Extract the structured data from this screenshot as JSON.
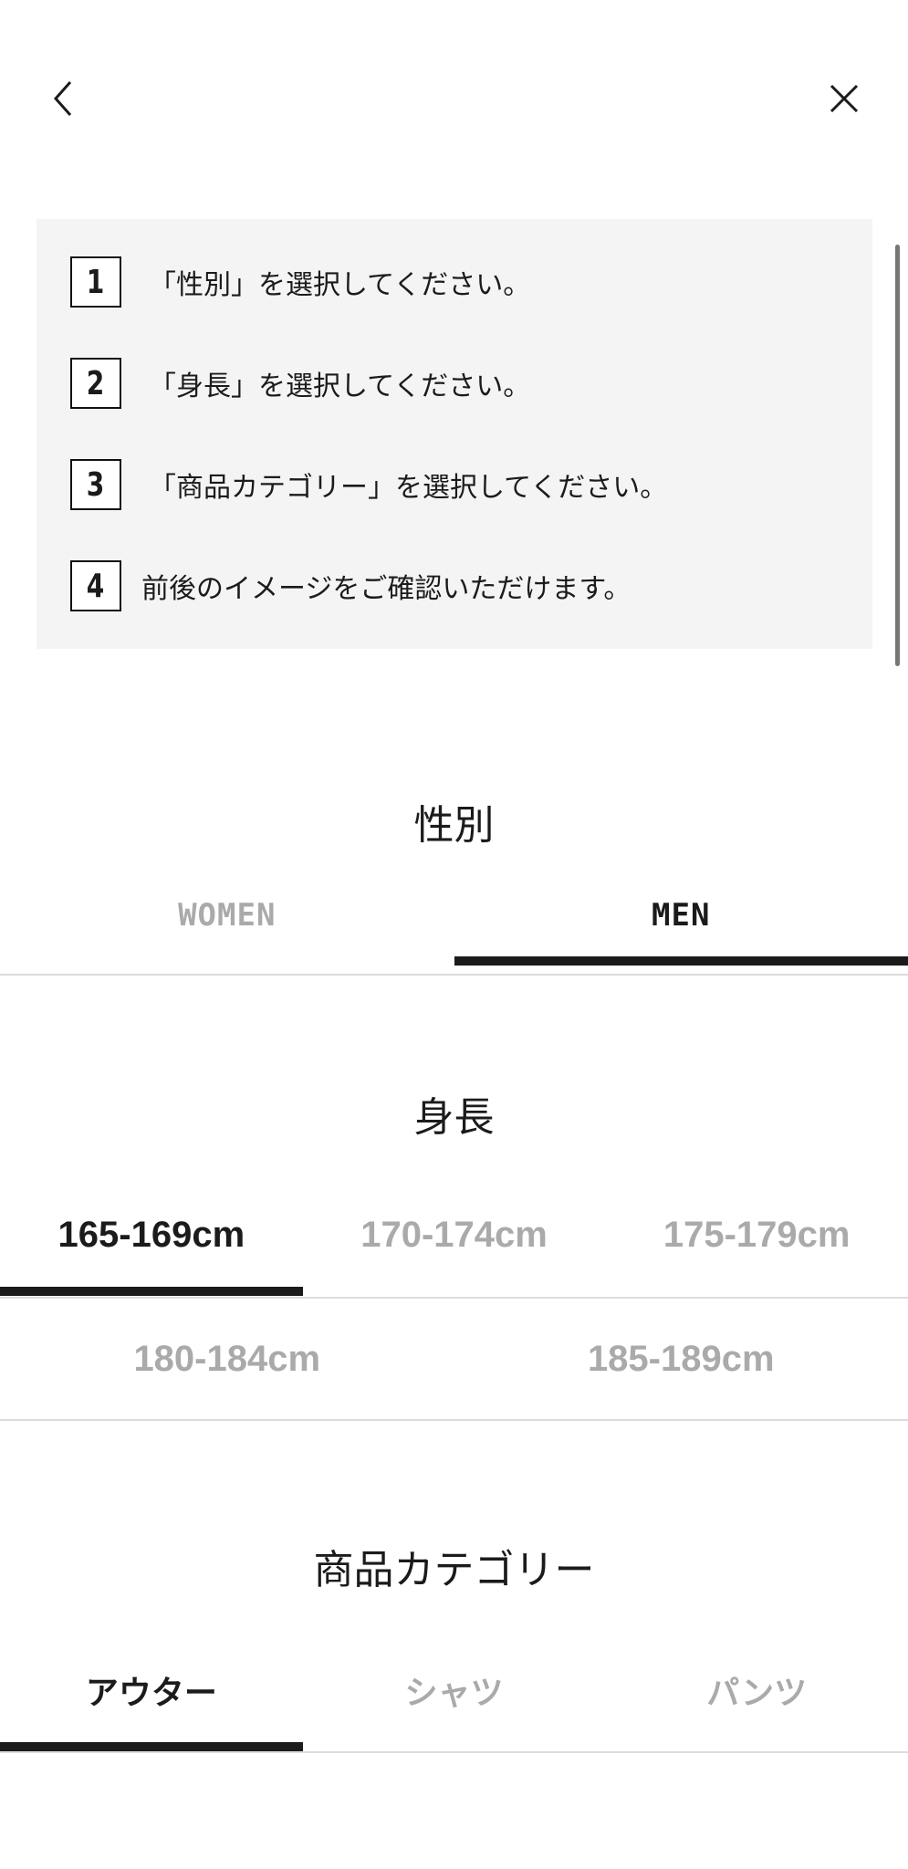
{
  "header": {
    "back_icon": "chevron-left-icon",
    "close_icon": "close-icon"
  },
  "instructions": [
    {
      "number": "1",
      "text": "「性別」を選択してください。"
    },
    {
      "number": "2",
      "text": "「身長」を選択してください。"
    },
    {
      "number": "3",
      "text": "「商品カテゴリー」を選択してください。"
    },
    {
      "number": "4",
      "text": "前後のイメージをご確認いただけます。"
    }
  ],
  "gender": {
    "title": "性別",
    "options": [
      {
        "label": "WOMEN",
        "selected": false
      },
      {
        "label": "MEN",
        "selected": true
      }
    ]
  },
  "height": {
    "title": "身長",
    "options": [
      {
        "label": "165-169cm",
        "selected": true
      },
      {
        "label": "170-174cm",
        "selected": false
      },
      {
        "label": "175-179cm",
        "selected": false
      },
      {
        "label": "180-184cm",
        "selected": false
      },
      {
        "label": "185-189cm",
        "selected": false
      }
    ]
  },
  "category": {
    "title": "商品カテゴリー",
    "options": [
      {
        "label": "アウター",
        "selected": true
      },
      {
        "label": "シャツ",
        "selected": false
      },
      {
        "label": "パンツ",
        "selected": false
      }
    ]
  },
  "colors": {
    "text": "#1b1b1b",
    "inactive": "#aaaaaa",
    "panel": "#f4f4f4",
    "divider": "#dcdcdc"
  }
}
